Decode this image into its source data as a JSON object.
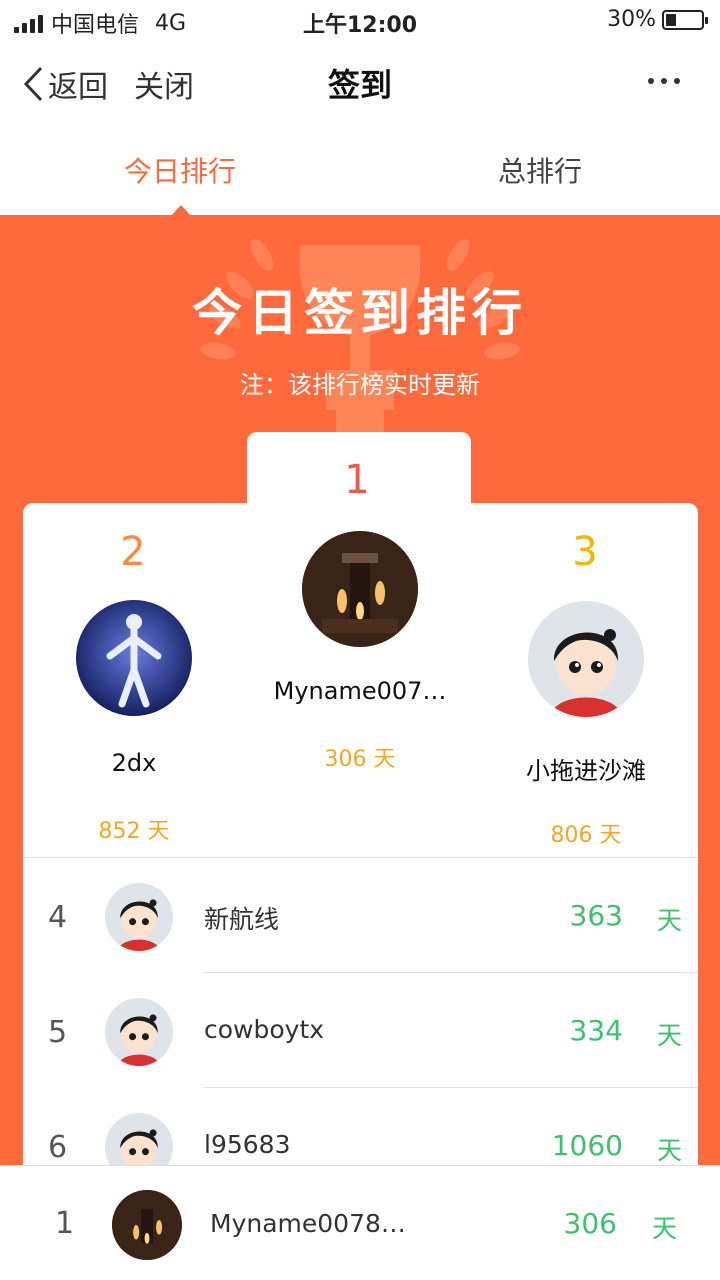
{
  "status_bar": {
    "carrier": "中国电信",
    "network": "4G",
    "time": "上午12:00",
    "battery_percent": "30%",
    "battery_level": 0.3
  },
  "nav": {
    "back_label": "返回",
    "close_label": "关闭",
    "title": "签到"
  },
  "tabs": [
    {
      "label": "今日排行",
      "active": true
    },
    {
      "label": "总排行",
      "active": false
    }
  ],
  "banner": {
    "title": "今日签到排行",
    "note": "注：该排行榜实时更新"
  },
  "podium": {
    "first": {
      "rank": "1",
      "name": "Myname007…",
      "days": "306 天"
    },
    "second": {
      "rank": "2",
      "name": "2dx",
      "days": "852 天"
    },
    "third": {
      "rank": "3",
      "name": "小拖进沙滩",
      "days": "806 天"
    }
  },
  "list": [
    {
      "rank": "4",
      "name": "新航线",
      "count": "363",
      "unit": "天"
    },
    {
      "rank": "5",
      "name": "cowboytx",
      "count": "334",
      "unit": "天"
    },
    {
      "rank": "6",
      "name": "l95683",
      "count": "1060",
      "unit": "天"
    }
  ],
  "me": {
    "rank": "1",
    "name": "Myname0078…",
    "count": "306",
    "unit": "天"
  },
  "colors": {
    "accent": "#ff6a3d",
    "gold": "#f5a623",
    "green": "#3ec16d",
    "rank1": "#f0584a",
    "rank2": "#ff8a3d",
    "rank3": "#f7b500"
  },
  "icons": {
    "back": "chevron-left-icon",
    "more": "more-dots-icon",
    "trophy": "trophy-icon",
    "laurel": "laurel-icon"
  }
}
